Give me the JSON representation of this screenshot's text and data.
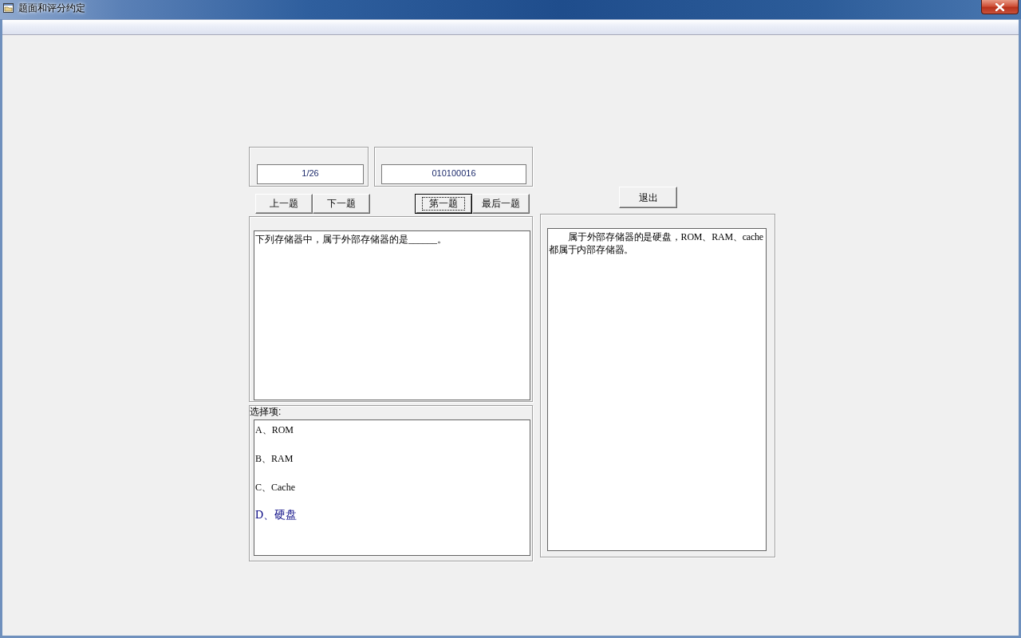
{
  "window": {
    "title": "题面和评分约定"
  },
  "counter": {
    "value": "1/26"
  },
  "question_id": {
    "value": "010100016"
  },
  "button_groups": [
    {
      "buttons": [
        {
          "label": "上一题",
          "focused": false
        },
        {
          "label": "下一题",
          "focused": false
        }
      ]
    },
    {
      "buttons": [
        {
          "label": "第一题",
          "focused": true
        },
        {
          "label": "最后一题",
          "focused": false
        }
      ]
    }
  ],
  "exit_button": {
    "label": "退出"
  },
  "question": {
    "text": "下列存储器中，属于外部存储器的是______。"
  },
  "options": {
    "caption": "选择项:",
    "items": [
      {
        "text": "A、ROM",
        "highlighted": false
      },
      {
        "text": "B、RAM",
        "highlighted": false
      },
      {
        "text": "C、Cache",
        "highlighted": false
      },
      {
        "text": "D、硬盘",
        "highlighted": true
      }
    ]
  },
  "explanation": {
    "text": "属于外部存储器的是硬盘，ROM、RAM、cache都属于内部存储器。"
  }
}
